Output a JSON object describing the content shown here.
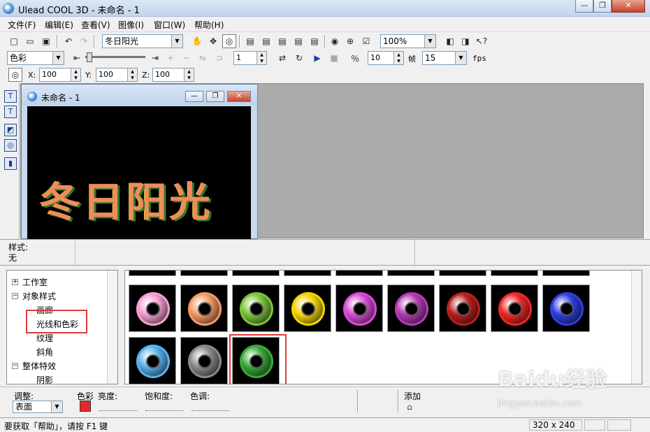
{
  "window": {
    "title": "Ulead COOL 3D - 未命名 - 1",
    "min": "—",
    "max": "❐",
    "close": "✕"
  },
  "menu": [
    "文件(F)",
    "编辑(E)",
    "查看(V)",
    "图像(I)",
    "窗口(W)",
    "帮助(H)"
  ],
  "toolbar1": {
    "text_combo": "冬日阳光",
    "zoom": "100%"
  },
  "toolbar2": {
    "color_combo": "色彩",
    "frame_value": "1",
    "time_value": "10",
    "frame_label": "帧",
    "fps_value": "15",
    "fps_label": "fps"
  },
  "toolbar3": {
    "x_label": "X:",
    "x_value": "100",
    "y_label": "Y:",
    "y_value": "100",
    "z_label": "Z:",
    "z_value": "100"
  },
  "child_window": {
    "title": "未命名 - 1",
    "min": "—",
    "max": "❐",
    "close": "✕"
  },
  "canvas_text": "冬日阳光",
  "style_panel": {
    "label": "样式:",
    "value": "无"
  },
  "tree": {
    "items": [
      {
        "label": "工作室",
        "expander": "+"
      },
      {
        "label": "对象样式",
        "expander": "−"
      },
      {
        "label": "画廊"
      },
      {
        "label": "光线和色彩"
      },
      {
        "label": "纹理"
      },
      {
        "label": "斜角"
      },
      {
        "label": "整体特效",
        "expander": "−"
      },
      {
        "label": "阴影"
      }
    ]
  },
  "thumbnails": {
    "row1_colors": [
      "#f59fd2",
      "#f49a68",
      "#7cc43c",
      "#f2d400",
      "#d84cd8",
      "#b43cb4",
      "#b82020",
      "#f02828",
      "#2e3ee0"
    ],
    "row2_colors": [
      "#5ab0e8",
      "#8a8a8a",
      "#3aa83a"
    ]
  },
  "bottom": {
    "adjust_label": "调整:",
    "adjust_value": "表面",
    "color_label": "色彩",
    "brightness_label": "亮度:",
    "saturation_label": "饱和度:",
    "hue_label": "色调:",
    "add_label": "添加",
    "accent": "#e82828"
  },
  "status": {
    "help_text": "要获取「帮助」，请按 F1 键",
    "size": "320 x 240"
  },
  "watermark": {
    "brand": "Baidu经验",
    "sub": "jingyan.baidu.com"
  }
}
